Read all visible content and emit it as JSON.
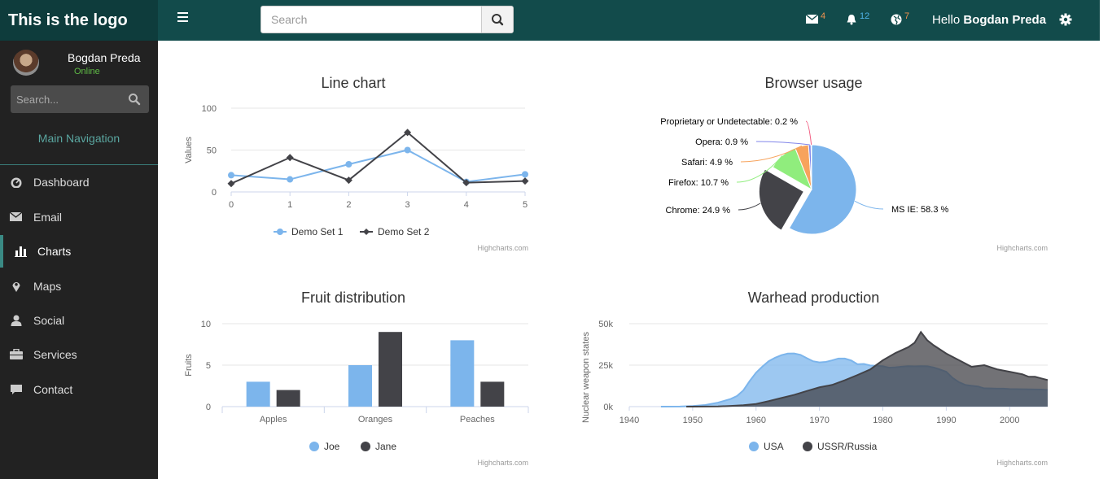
{
  "header": {
    "logo": "This is the logo",
    "search_placeholder": "Search",
    "mail_count": "4",
    "bell_count": "12",
    "globe_count": "7",
    "hello_prefix": "Hello",
    "user_name": "Bogdan Preda",
    "colors": {
      "bar": "#124b4b",
      "logo_bg": "#0e3c3c",
      "mail": "#f0924f",
      "bell": "#4fb3e8",
      "globe": "#f0924f"
    }
  },
  "sidebar": {
    "user_name": "Bogdan Preda",
    "status": "Online",
    "search_placeholder": "Search...",
    "nav_header": "Main Navigation",
    "items": [
      {
        "label": "Dashboard",
        "icon": "dashboard-icon"
      },
      {
        "label": "Email",
        "icon": "envelope-icon"
      },
      {
        "label": "Charts",
        "icon": "bar-chart-icon",
        "active": true
      },
      {
        "label": "Maps",
        "icon": "map-marker-icon"
      },
      {
        "label": "Social",
        "icon": "user-icon"
      },
      {
        "label": "Services",
        "icon": "briefcase-icon"
      },
      {
        "label": "Contact",
        "icon": "comment-icon"
      }
    ]
  },
  "credit": "Highcharts.com",
  "chart_data": [
    {
      "type": "line",
      "title": "Line chart",
      "ylabel": "Values",
      "x": [
        0,
        1,
        2,
        3,
        4,
        5
      ],
      "ylim": [
        0,
        100
      ],
      "yticks": [
        0,
        50,
        100
      ],
      "series": [
        {
          "name": "Demo Set 1",
          "values": [
            20,
            15,
            33,
            50,
            12,
            21
          ],
          "color": "#7cb5ec",
          "marker": "circle"
        },
        {
          "name": "Demo Set 2",
          "values": [
            10,
            41,
            14,
            71,
            11,
            13
          ],
          "color": "#434348",
          "marker": "diamond"
        }
      ],
      "legend": "bottom"
    },
    {
      "type": "pie",
      "title": "Browser usage",
      "slices": [
        {
          "name": "MS IE",
          "value": 58.3,
          "color": "#7cb5ec",
          "label": "MS IE: 58.3 %"
        },
        {
          "name": "Chrome",
          "value": 24.9,
          "color": "#434348",
          "label": "Chrome: 24.9 %"
        },
        {
          "name": "Firefox",
          "value": 10.7,
          "color": "#90ed7d",
          "label": "Firefox: 10.7 %"
        },
        {
          "name": "Safari",
          "value": 4.9,
          "color": "#f7a35c",
          "label": "Safari: 4.9 %"
        },
        {
          "name": "Opera",
          "value": 0.9,
          "color": "#8085e9",
          "label": "Opera: 0.9 %"
        },
        {
          "name": "Proprietary or Undetectable",
          "value": 0.2,
          "color": "#f15c80",
          "label": "Proprietary or Undetectable: 0.2 %"
        }
      ]
    },
    {
      "type": "bar",
      "title": "Fruit distribution",
      "ylabel": "Fruits",
      "categories": [
        "Apples",
        "Oranges",
        "Peaches"
      ],
      "ylim": [
        0,
        10
      ],
      "yticks": [
        0,
        5,
        10
      ],
      "series": [
        {
          "name": "Joe",
          "values": [
            3,
            5,
            8
          ],
          "color": "#7cb5ec"
        },
        {
          "name": "Jane",
          "values": [
            2,
            9,
            3
          ],
          "color": "#434348"
        }
      ],
      "legend": "bottom"
    },
    {
      "type": "area",
      "title": "Warhead production",
      "ylabel": "Nuclear weapon states",
      "xlim": [
        1940,
        2006
      ],
      "xticks": [
        1940,
        1950,
        1960,
        1970,
        1980,
        1990,
        2000
      ],
      "ylim": [
        0,
        50000
      ],
      "yticks": [
        0,
        25000,
        50000
      ],
      "ytick_labels": [
        "0k",
        "25k",
        "50k"
      ],
      "series": [
        {
          "name": "USA",
          "color": "#7cb5ec",
          "x": [
            1945,
            1948,
            1950,
            1952,
            1954,
            1956,
            1957,
            1958,
            1959,
            1960,
            1961,
            1962,
            1963,
            1964,
            1965,
            1966,
            1967,
            1968,
            1969,
            1970,
            1971,
            1972,
            1973,
            1974,
            1975,
            1976,
            1977,
            1978,
            1979,
            1980,
            1981,
            1982,
            1983,
            1984,
            1985,
            1986,
            1987,
            1988,
            1989,
            1990,
            1991,
            1992,
            1993,
            1994,
            1995,
            1996,
            1997,
            1998,
            1999,
            2000,
            2001,
            2002,
            2003,
            2004,
            2005,
            2006
          ],
          "values": [
            6,
            50,
            369,
            1005,
            2422,
            4618,
            6444,
            9822,
            15468,
            20434,
            24126,
            27387,
            29459,
            31056,
            31982,
            32040,
            31233,
            29224,
            27342,
            26662,
            26956,
            27912,
            28999,
            28965,
            27826,
            25579,
            25722,
            24826,
            24605,
            24304,
            23464,
            23708,
            24099,
            24357,
            24237,
            24401,
            24344,
            23586,
            22380,
            21004,
            17287,
            14747,
            13076,
            12555,
            12144,
            11009,
            10950,
            10871,
            10824,
            10577,
            10527,
            10475,
            10421,
            10358,
            10295,
            10104
          ]
        },
        {
          "name": "USSR/Russia",
          "color": "#434348",
          "x": [
            1949,
            1950,
            1952,
            1954,
            1956,
            1958,
            1960,
            1962,
            1964,
            1966,
            1968,
            1970,
            1972,
            1974,
            1976,
            1978,
            1980,
            1982,
            1984,
            1985,
            1986,
            1987,
            1988,
            1990,
            1992,
            1994,
            1996,
            1998,
            2000,
            2002,
            2003,
            2004,
            2005,
            2006
          ],
          "values": [
            1,
            5,
            50,
            150,
            426,
            869,
            1605,
            3322,
            5221,
            7089,
            9399,
            11643,
            13092,
            15915,
            19055,
            22380,
            27935,
            32335,
            35804,
            38479,
            44979,
            40000,
            37000,
            32000,
            28000,
            24000,
            25000,
            22500,
            21000,
            19500,
            18000,
            18000,
            17000,
            16000
          ]
        }
      ],
      "legend": "bottom"
    }
  ]
}
